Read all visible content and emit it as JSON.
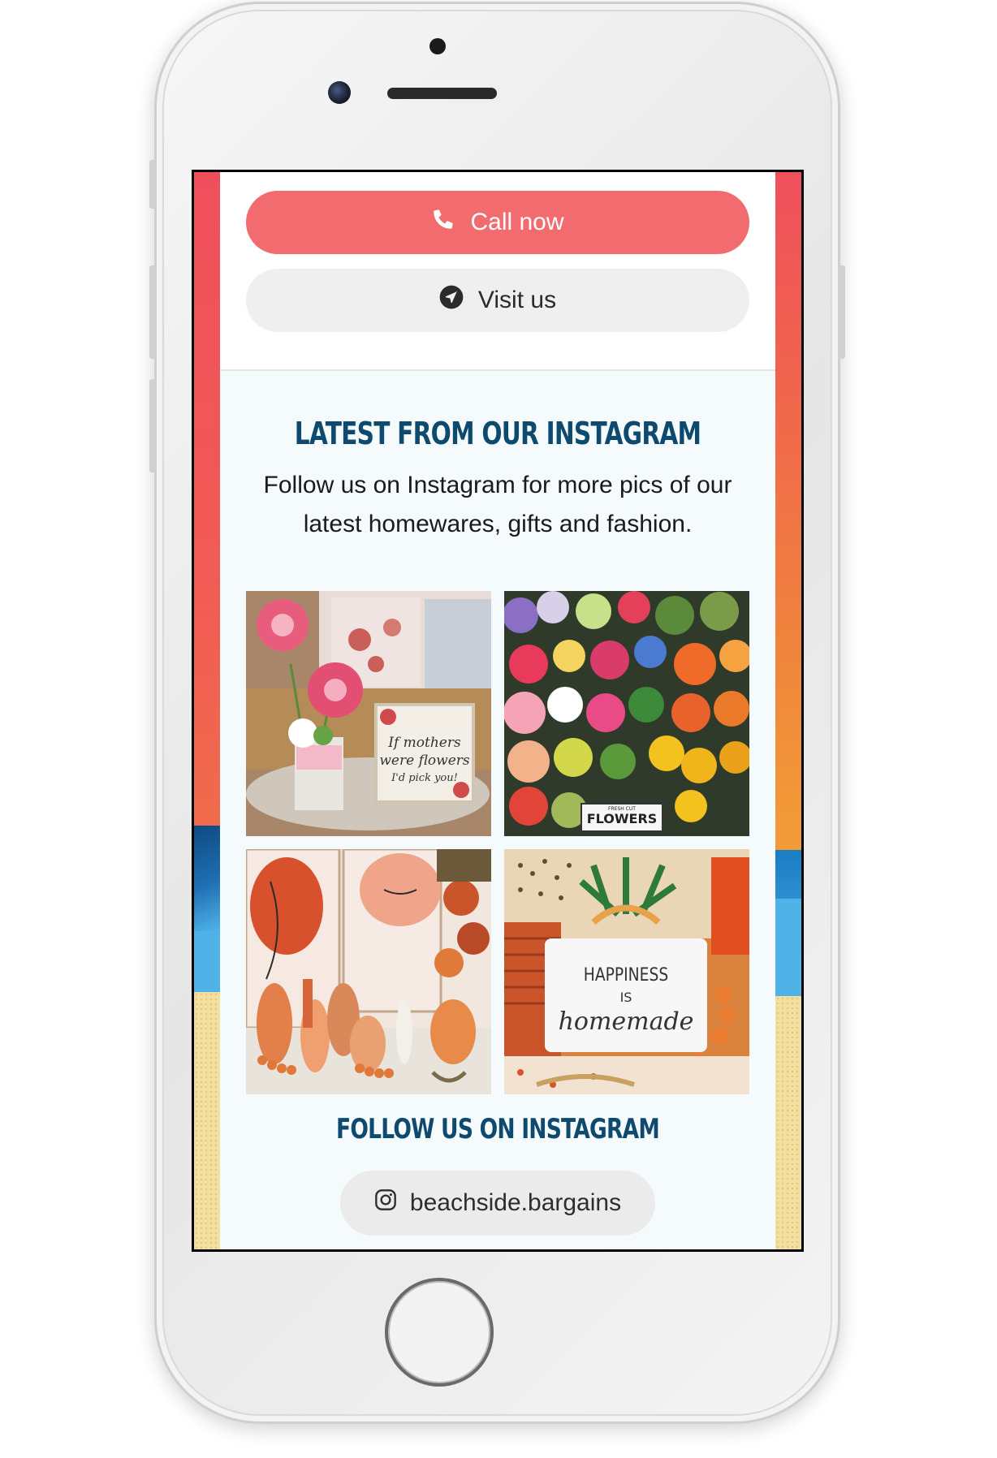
{
  "actions": {
    "call_label": "Call now",
    "visit_label": "Visit us"
  },
  "instagram": {
    "heading": "LATEST FROM OUR INSTAGRAM",
    "intro": "Follow us on Instagram for more pics of our latest homewares, gifts and fashion.",
    "follow_heading": "FOLLOW US ON INSTAGRAM",
    "handle": "beachside.bargains",
    "posts": [
      {
        "caption_text": "If mothers were flowers I'd pick you!"
      },
      {
        "caption_text": "FRESH CUT FLOWERS"
      },
      {
        "caption_text": ""
      },
      {
        "caption_text": "HAPPINESS IS homemade"
      }
    ]
  },
  "colors": {
    "call_button": "#f26b6f",
    "heading": "#0e4a6e",
    "section_bg": "#f5fafd",
    "band_top": "#ef4f5c",
    "band_mid": "#f08a3a",
    "band_blue": "#4fb3e8",
    "band_sand": "#f3dfa0"
  },
  "icons": {
    "call": "phone-icon",
    "visit": "location-arrow-icon",
    "handle": "instagram-icon"
  }
}
